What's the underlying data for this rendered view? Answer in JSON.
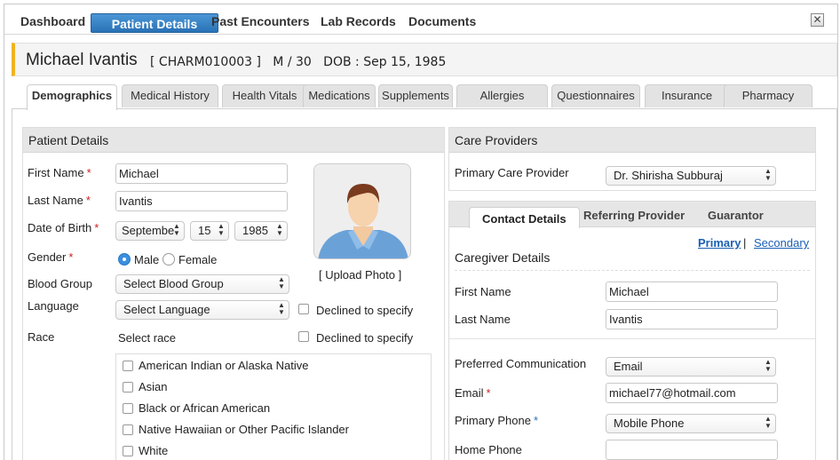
{
  "nav": {
    "items": [
      "Dashboard",
      "Patient Details",
      "Past Encounters",
      "Lab Records",
      "Documents"
    ],
    "active_index": 1,
    "close_label": "✕"
  },
  "patient": {
    "name": "Michael Ivantis",
    "meta": "[ CHARM010003 ]   M / 30   DOB : Sep 15, 1985"
  },
  "tabs": [
    "Demographics",
    "Medical History",
    "Health Vitals",
    "Medications",
    "Supplements",
    "Allergies",
    "Questionnaires",
    "Insurance",
    "Pharmacy"
  ],
  "active_tab": "Demographics",
  "patient_details": {
    "heading": "Patient Details",
    "first_name_label": "First Name",
    "first_name": "Michael",
    "last_name_label": "Last Name",
    "last_name": "Ivantis",
    "dob_label": "Date of Birth",
    "dob_month": "Septembe",
    "dob_day": "15",
    "dob_year": "1985",
    "gender_label": "Gender",
    "gender_options": [
      "Male",
      "Female"
    ],
    "gender_selected": "Male",
    "blood_group_label": "Blood Group",
    "blood_group_value": "Select Blood Group",
    "language_label": "Language",
    "language_value": "Select Language",
    "declined_label": "Declined to specify",
    "race_label": "Race",
    "race_select_label": "Select race",
    "race_options": [
      "American Indian or Alaska Native",
      "Asian",
      "Black or African American",
      "Native Hawaiian or Other Pacific Islander",
      "White"
    ],
    "upload_photo": "[ Upload Photo ]"
  },
  "care_providers": {
    "heading": "Care Providers",
    "pcp_label": "Primary Care Provider",
    "pcp_value": "Dr. Shirisha Subburaj"
  },
  "contact": {
    "tabs": [
      "Contact Details",
      "Referring Provider",
      "Guarantor"
    ],
    "active_tab": "Contact Details",
    "primary_link": "Primary",
    "separator": "|",
    "secondary_link": "Secondary",
    "caregiver_heading": "Caregiver Details",
    "first_name_label": "First Name",
    "first_name": "Michael",
    "last_name_label": "Last Name",
    "last_name": "Ivantis",
    "pref_comm_label": "Preferred Communication",
    "pref_comm_value": "Email",
    "email_label": "Email",
    "email": "michael77@hotmail.com",
    "primary_phone_label": "Primary Phone",
    "primary_phone_value": "Mobile Phone",
    "home_phone_label": "Home Phone",
    "home_phone": ""
  },
  "colors": {
    "accent": "#2a72b6",
    "header_stripe": "#f0b323",
    "required": "#cc2222",
    "link": "#1a5fb4"
  }
}
